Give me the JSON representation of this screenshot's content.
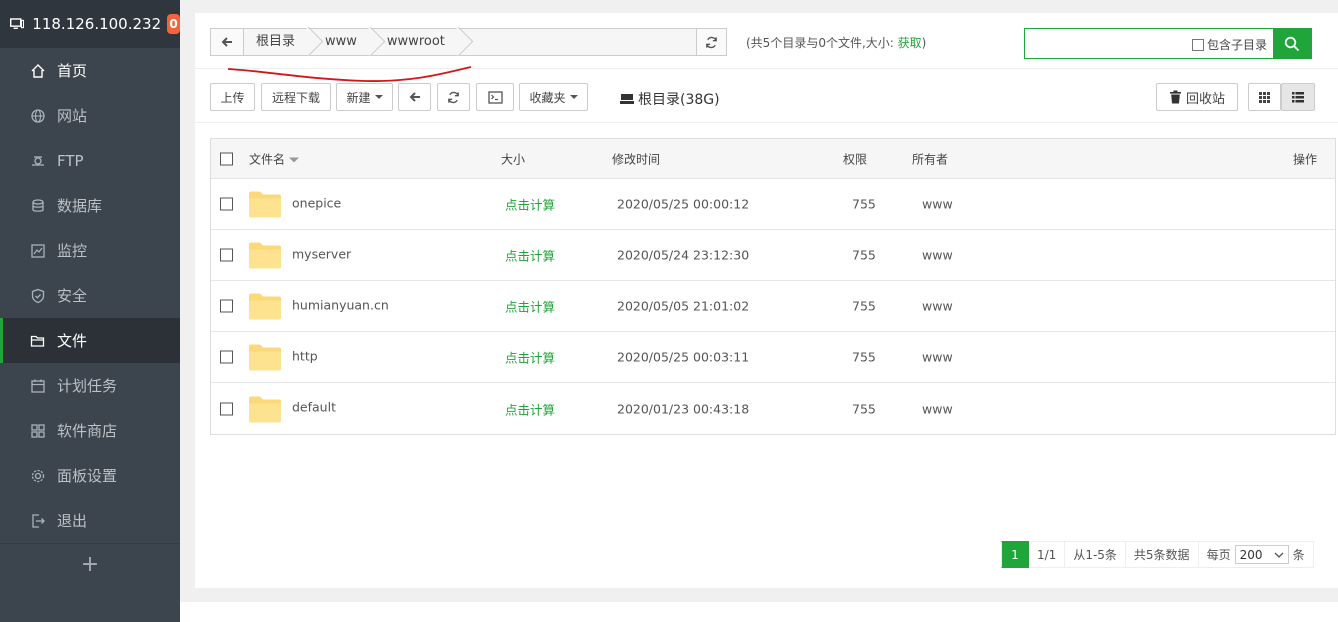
{
  "server": {
    "ip": "118.126.100.232",
    "badge": "0"
  },
  "sidebar": {
    "items": [
      {
        "label": "首页",
        "icon": "home-icon"
      },
      {
        "label": "网站",
        "icon": "globe-icon"
      },
      {
        "label": "FTP",
        "icon": "ftp-icon"
      },
      {
        "label": "数据库",
        "icon": "database-icon"
      },
      {
        "label": "监控",
        "icon": "monitor-chart-icon"
      },
      {
        "label": "安全",
        "icon": "shield-icon"
      },
      {
        "label": "文件",
        "icon": "folder-icon"
      },
      {
        "label": "计划任务",
        "icon": "calendar-icon"
      },
      {
        "label": "软件商店",
        "icon": "grid-icon"
      },
      {
        "label": "面板设置",
        "icon": "gear-icon"
      },
      {
        "label": "退出",
        "icon": "logout-icon"
      }
    ],
    "active_index": 6,
    "add_label": "+"
  },
  "breadcrumb": [
    "根目录",
    "www",
    "wwwroot"
  ],
  "summary": {
    "text": "(共5个目录与0个文件,大小:",
    "link": "获取",
    "close": ")"
  },
  "search": {
    "placeholder": "",
    "subdir_label": "包含子目录"
  },
  "toolbar": {
    "upload": "上传",
    "remote_download": "远程下载",
    "new": "新建",
    "favorites": "收藏夹",
    "disk": "根目录(38G)",
    "recycle": "回收站"
  },
  "table": {
    "headers": {
      "name": "文件名",
      "size": "大小",
      "mtime": "修改时间",
      "perm": "权限",
      "owner": "所有者",
      "action": "操作"
    },
    "rows": [
      {
        "name": "onepice",
        "size": "点击计算",
        "mtime": "2020/05/25 00:00:12",
        "perm": "755",
        "owner": "www"
      },
      {
        "name": "myserver",
        "size": "点击计算",
        "mtime": "2020/05/24 23:12:30",
        "perm": "755",
        "owner": "www"
      },
      {
        "name": "humianyuan.cn",
        "size": "点击计算",
        "mtime": "2020/05/05 21:01:02",
        "perm": "755",
        "owner": "www"
      },
      {
        "name": "http",
        "size": "点击计算",
        "mtime": "2020/05/25 00:03:11",
        "perm": "755",
        "owner": "www"
      },
      {
        "name": "default",
        "size": "点击计算",
        "mtime": "2020/01/23 00:43:18",
        "perm": "755",
        "owner": "www"
      }
    ]
  },
  "pager": {
    "current": "1",
    "pages": "1/1",
    "range": "从1-5条",
    "total": "共5条数据",
    "per_page_label": "每页",
    "per_page_value": "200",
    "per_page_unit": "条"
  },
  "colors": {
    "accent": "#20a53a",
    "sidebar": "#3c444d",
    "badge": "#f0653d",
    "annotation": "#d0181c"
  }
}
